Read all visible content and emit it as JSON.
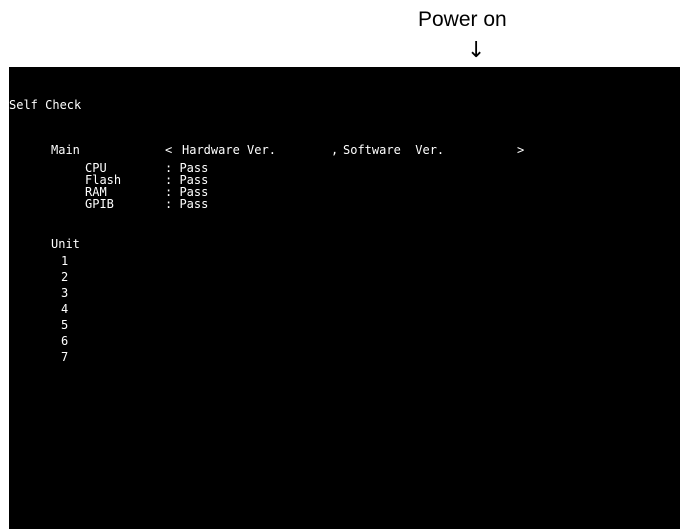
{
  "caption": {
    "power_label": "Power on",
    "arrow": "↓"
  },
  "screen": {
    "title": "Self Check",
    "main": {
      "label": "Main",
      "version_line": {
        "open": "<",
        "hardware": "Hardware Ver.",
        "sep": ",",
        "software": "Software  Ver.",
        "close": ">"
      },
      "checks": [
        {
          "name": "CPU",
          "result": ": Pass"
        },
        {
          "name": "Flash",
          "result": ": Pass"
        },
        {
          "name": "RAM",
          "result": ": Pass"
        },
        {
          "name": "GPIB",
          "result": ": Pass"
        }
      ]
    },
    "unit": {
      "label": "Unit",
      "items": [
        "1",
        "2",
        "3",
        "4",
        "5",
        "6",
        "7"
      ]
    }
  },
  "colors": {
    "screen_bg": "#000000",
    "screen_text": "#ffffff",
    "page_bg": "#ffffff"
  }
}
